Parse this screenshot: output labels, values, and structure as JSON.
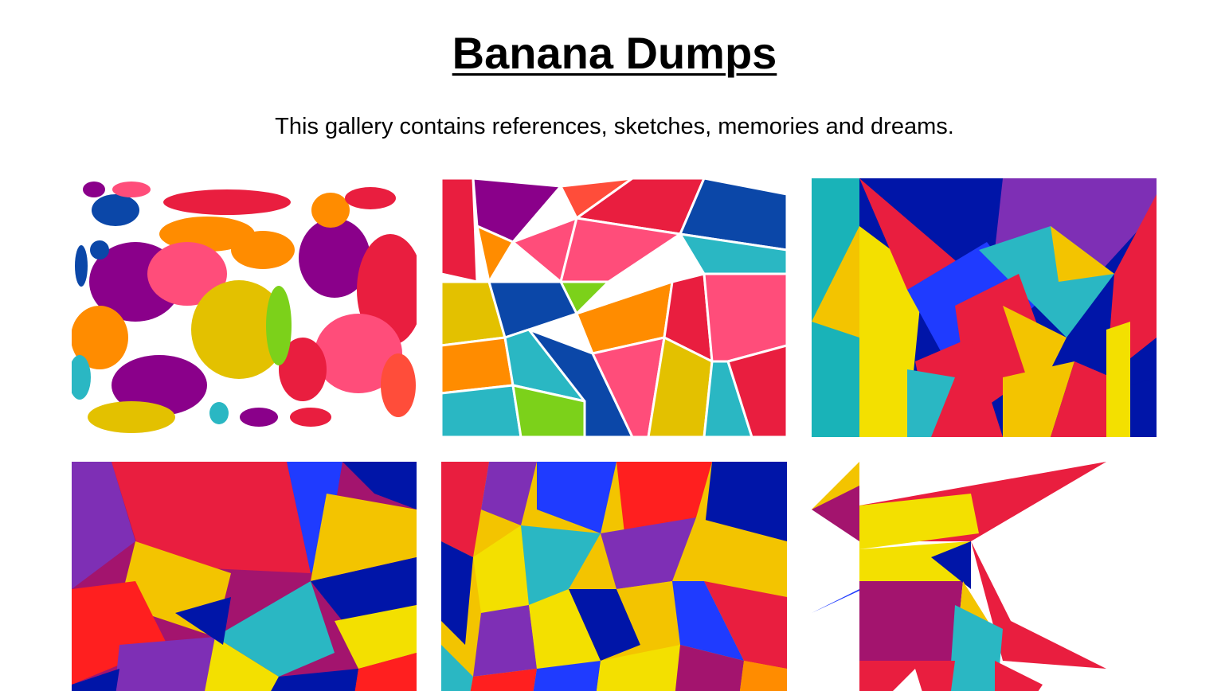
{
  "header": {
    "title": "Banana Dumps",
    "subtitle": "This gallery contains references, sketches, memories and dreams."
  },
  "gallery": {
    "palette": [
      "#e91e3f",
      "#f3c400",
      "#2ab7c3",
      "#8a008a",
      "#0b47a8",
      "#ff8c00",
      "#ff4d7a",
      "#7cd11a",
      "#1f3bff",
      "#7e2fb5",
      "#0015a8",
      "#a3146e"
    ],
    "items": [
      {
        "style": "organic-blobs-white-gaps"
      },
      {
        "style": "organic-cells-white-lines"
      },
      {
        "style": "angular-shards"
      },
      {
        "style": "angular-shards"
      },
      {
        "style": "angular-shards-dense"
      },
      {
        "style": "angular-bird-on-white"
      }
    ]
  }
}
